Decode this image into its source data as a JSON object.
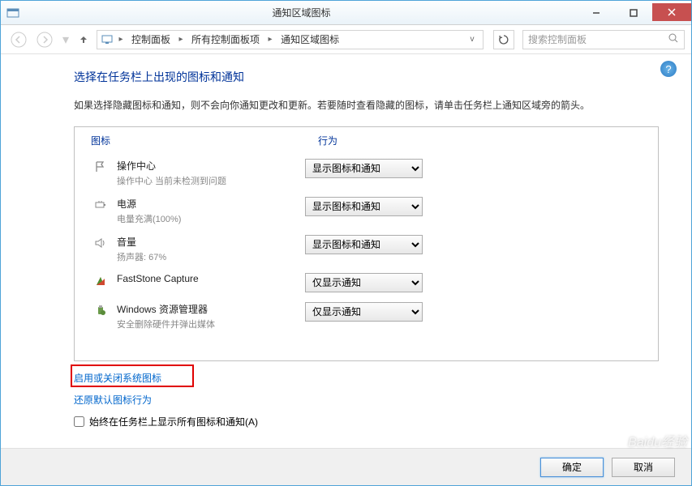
{
  "window": {
    "title": "通知区域图标"
  },
  "nav": {
    "breadcrumb": [
      "控制面板",
      "所有控制面板项",
      "通知区域图标"
    ],
    "search_placeholder": "搜索控制面板"
  },
  "page": {
    "title": "选择在任务栏上出现的图标和通知",
    "description": "如果选择隐藏图标和通知，则不会向你通知更改和更新。若要随时查看隐藏的图标，请单击任务栏上通知区域旁的箭头。",
    "col_icon": "图标",
    "col_behavior": "行为"
  },
  "icons": [
    {
      "name": "操作中心",
      "sub": "操作中心 当前未检测到问题",
      "behavior": "显示图标和通知",
      "icon": "flag"
    },
    {
      "name": "电源",
      "sub": "电量充满(100%)",
      "behavior": "显示图标和通知",
      "icon": "battery"
    },
    {
      "name": "音量",
      "sub": "扬声器: 67%",
      "behavior": "显示图标和通知",
      "icon": "speaker"
    },
    {
      "name": "FastStone Capture",
      "sub": "",
      "behavior": "仅显示通知",
      "icon": "faststone"
    },
    {
      "name": "Windows 资源管理器",
      "sub": "安全删除硬件并弹出媒体",
      "behavior": "仅显示通知",
      "icon": "usb"
    }
  ],
  "links": {
    "toggle_system": "启用或关闭系统图标",
    "restore_default": "还原默认图标行为"
  },
  "checkbox": {
    "label": "始终在任务栏上显示所有图标和通知(A)"
  },
  "footer": {
    "ok": "确定",
    "cancel": "取消"
  },
  "watermark": "Baidu经验"
}
